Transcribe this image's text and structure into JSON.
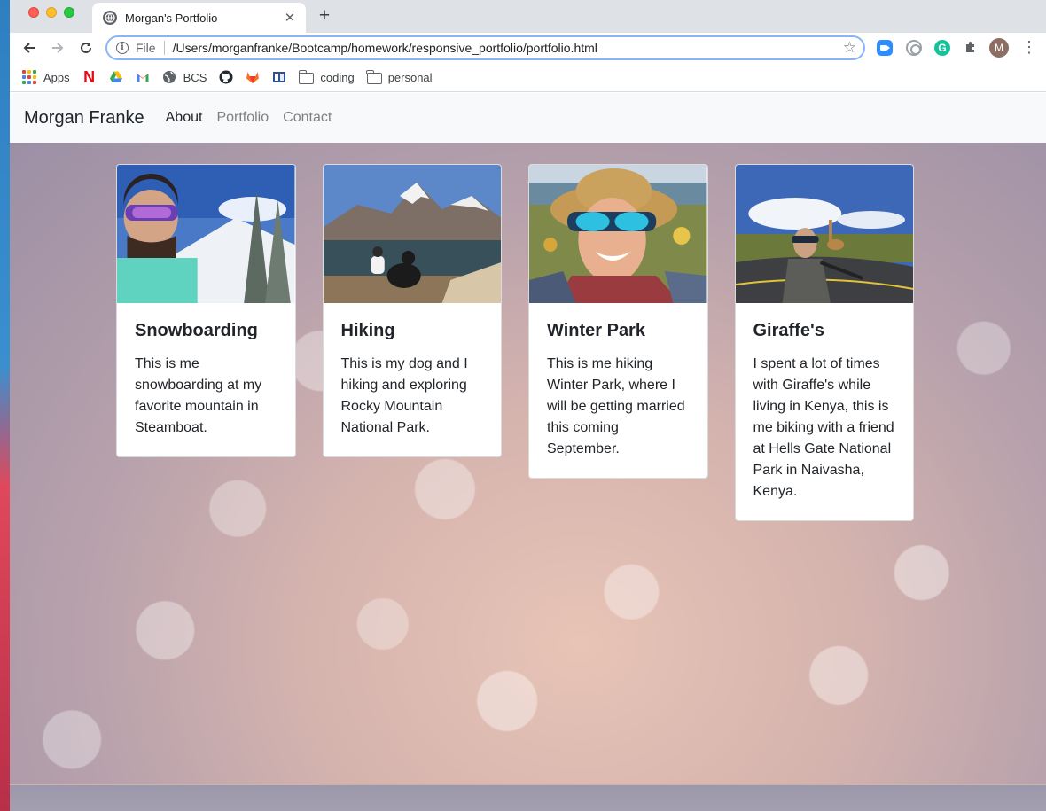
{
  "browser": {
    "tab_title": "Morgan's Portfolio",
    "omnibox_scheme": "File",
    "url": "/Users/morganfranke/Bootcamp/homework/responsive_portfolio/portfolio.html",
    "profile_initial": "M",
    "extension_grammarly_letter": "G",
    "bookmarks": [
      {
        "icon": "apps-icon",
        "label": "Apps"
      },
      {
        "icon": "netflix-icon",
        "label": ""
      },
      {
        "icon": "google-drive-icon",
        "label": ""
      },
      {
        "icon": "gmail-icon",
        "label": ""
      },
      {
        "icon": "globe-icon",
        "label": "BCS"
      },
      {
        "icon": "github-icon",
        "label": ""
      },
      {
        "icon": "gitlab-icon",
        "label": ""
      },
      {
        "icon": "bookmark-site-icon",
        "label": ""
      },
      {
        "icon": "folder-icon",
        "label": "coding"
      },
      {
        "icon": "folder-icon",
        "label": "personal"
      }
    ]
  },
  "site": {
    "brand": "Morgan Franke",
    "nav": [
      {
        "label": "About",
        "active": true
      },
      {
        "label": "Portfolio",
        "active": false
      },
      {
        "label": "Contact",
        "active": false
      }
    ],
    "cards": [
      {
        "title": "Snowboarding",
        "text": "This is me snowboarding at my favorite mountain in Steamboat."
      },
      {
        "title": "Hiking",
        "text": "This is my dog and I hiking and exploring Rocky Mountain National Park."
      },
      {
        "title": "Winter Park",
        "text": "This is me hiking Winter Park, where I will be getting married this coming September."
      },
      {
        "title": "Giraffe's",
        "text": "I spent a lot of times with Giraffe's while living in Kenya, this is me biking with a friend at Hells Gate National Park in Naivasha, Kenya."
      }
    ]
  }
}
